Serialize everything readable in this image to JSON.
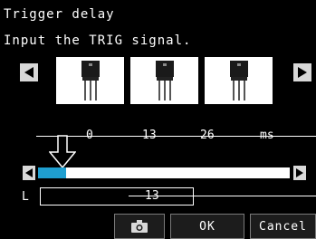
{
  "header": {
    "title": "Trigger delay",
    "instruction": "Input the TRIG signal."
  },
  "thumbnails": [
    {
      "icon": "transistor-component-image"
    },
    {
      "icon": "transistor-component-image"
    },
    {
      "icon": "transistor-component-image"
    }
  ],
  "scale": {
    "ticks": [
      "0",
      "13",
      "26",
      "ms"
    ]
  },
  "slider": {
    "fill_color": "#1f9fd0",
    "fill_fraction": 0.11
  },
  "delay": {
    "label": "L",
    "value": "13"
  },
  "footer": {
    "camera_icon": "camera-icon",
    "ok_label": "OK",
    "cancel_label": "Cancel"
  }
}
